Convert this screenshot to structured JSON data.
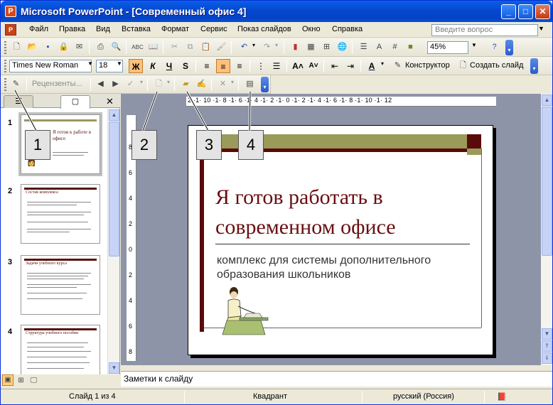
{
  "window": {
    "title": "Microsoft PowerPoint - [Современный офис 4]",
    "app_icon_glyph": "P"
  },
  "menu": {
    "items": [
      "Файл",
      "Правка",
      "Вид",
      "Вставка",
      "Формат",
      "Сервис",
      "Показ слайдов",
      "Окно",
      "Справка"
    ],
    "ask_placeholder": "Введите вопрос"
  },
  "toolbar_standard": {
    "zoom": "45%"
  },
  "toolbar_format": {
    "font_name": "Times New Roman",
    "font_size": "18",
    "bold_glyph": "Ж",
    "italic_glyph": "К",
    "underline_glyph": "Ч",
    "shadow_glyph": "S",
    "designer_label": "Конструктор",
    "new_slide_label": "Создать слайд"
  },
  "toolbar_review": {
    "reviewers_label": "Рецензенты..."
  },
  "ruler": {
    "h_labels": "2 ·1· 10 ·1· 8 ·1· 6 ·1· 4 ·1· 2 ·1· 0 ·1· 2 ·1· 4 ·1· 6 ·1· 8 ·1· 10 ·1· 12",
    "v_labels": [
      "8",
      "6",
      "4",
      "2",
      "0",
      "2",
      "4",
      "6",
      "8"
    ]
  },
  "slides": [
    {
      "num": "1",
      "title": "Я готов к работе в офисе"
    },
    {
      "num": "2",
      "title": "Состав комплекса"
    },
    {
      "num": "3",
      "title": "Задачи учебного курса"
    },
    {
      "num": "4",
      "title": "Структура учебного пособия"
    }
  ],
  "slide": {
    "title": "Я готов работать в современном офисе",
    "subtitle": "комплекс для системы дополнительного образования школьников",
    "colors": {
      "title": "#6A0E12",
      "dark_bar": "#5A0A0A",
      "olive_bar": "#9A9A5A"
    }
  },
  "notes": {
    "placeholder": "Заметки к слайду"
  },
  "status": {
    "slide": "Слайд 1 из 4",
    "design": "Квадрант",
    "language": "русский (Россия)"
  },
  "callouts": [
    "1",
    "2",
    "3",
    "4"
  ]
}
